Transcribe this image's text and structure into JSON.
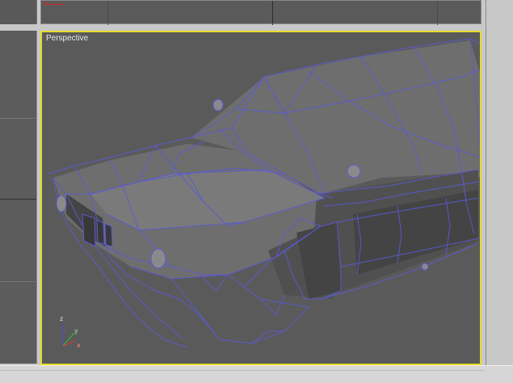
{
  "viewports": {
    "active": {
      "label": "Perspective"
    }
  },
  "colors": {
    "active_border": "#e6dc28",
    "wire": "#5a5ad6",
    "viewport_bg": "#5a5a5a",
    "ui_gray": "#c8c8c8"
  },
  "axis_gizmo": {
    "axes": [
      "x",
      "y",
      "z"
    ]
  }
}
